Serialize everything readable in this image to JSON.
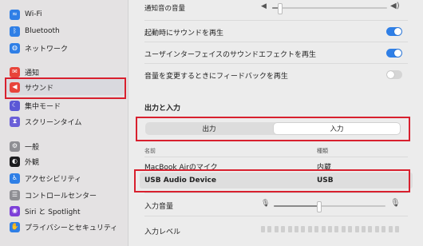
{
  "sidebar": {
    "items": [
      {
        "label": "Wi-Fi",
        "icon": "wifi-icon",
        "color": "#2f7fe6",
        "glyph": "≈"
      },
      {
        "label": "Bluetooth",
        "icon": "bluetooth-icon",
        "color": "#2f7fe6",
        "glyph": "ᛒ"
      },
      {
        "label": "ネットワーク",
        "icon": "globe-icon",
        "color": "#2f7fe6",
        "glyph": "◍"
      },
      {
        "label": "通知",
        "icon": "bell-icon",
        "color": "#e8443a",
        "glyph": "✉"
      },
      {
        "label": "サウンド",
        "icon": "speaker-icon",
        "color": "#e8443a",
        "glyph": "◀"
      },
      {
        "label": "集中モード",
        "icon": "moon-icon",
        "color": "#5b58d6",
        "glyph": "☾"
      },
      {
        "label": "スクリーンタイム",
        "icon": "hourglass-icon",
        "color": "#6a5fd8",
        "glyph": "⧗"
      },
      {
        "label": "一般",
        "icon": "gear-icon",
        "color": "#8e8e93",
        "glyph": "⚙"
      },
      {
        "label": "外観",
        "icon": "appearance-icon",
        "color": "#1c1c1e",
        "glyph": "◐"
      },
      {
        "label": "アクセシビリティ",
        "icon": "accessibility-icon",
        "color": "#2f7fe6",
        "glyph": "♿"
      },
      {
        "label": "コントロールセンター",
        "icon": "control-center-icon",
        "color": "#8e8e93",
        "glyph": "☰"
      },
      {
        "label": "Siri と Spotlight",
        "icon": "siri-icon",
        "color": "#7d3fd8",
        "glyph": "◉"
      },
      {
        "label": "プライバシーとセキュリティ",
        "icon": "hand-icon",
        "color": "#2f7fe6",
        "glyph": "✋"
      }
    ],
    "selected_index": 4
  },
  "main": {
    "alert_volume_label": "通知音の音量",
    "alert_volume_level": 0.06,
    "toggles": [
      {
        "label": "起動時にサウンドを再生",
        "on": true
      },
      {
        "label": "ユーザインターフェイスのサウンドエフェクトを再生",
        "on": true
      },
      {
        "label": "音量を変更するときにフィードバックを再生",
        "on": false
      }
    ],
    "section_title": "出力と入力",
    "segment": {
      "output": "出力",
      "input": "入力",
      "selected": "input"
    },
    "columns": {
      "name": "名前",
      "type": "種類"
    },
    "devices": [
      {
        "name": "MacBook Airのマイク",
        "type": "内蔵"
      },
      {
        "name": "USB Audio Device",
        "type": "USB"
      }
    ],
    "input_volume_label": "入力音量",
    "input_volume_level": 0.4,
    "input_level_label": "入力レベル"
  },
  "colors": {
    "accent": "#2f7fe6",
    "highlight_red": "#d8202e"
  }
}
